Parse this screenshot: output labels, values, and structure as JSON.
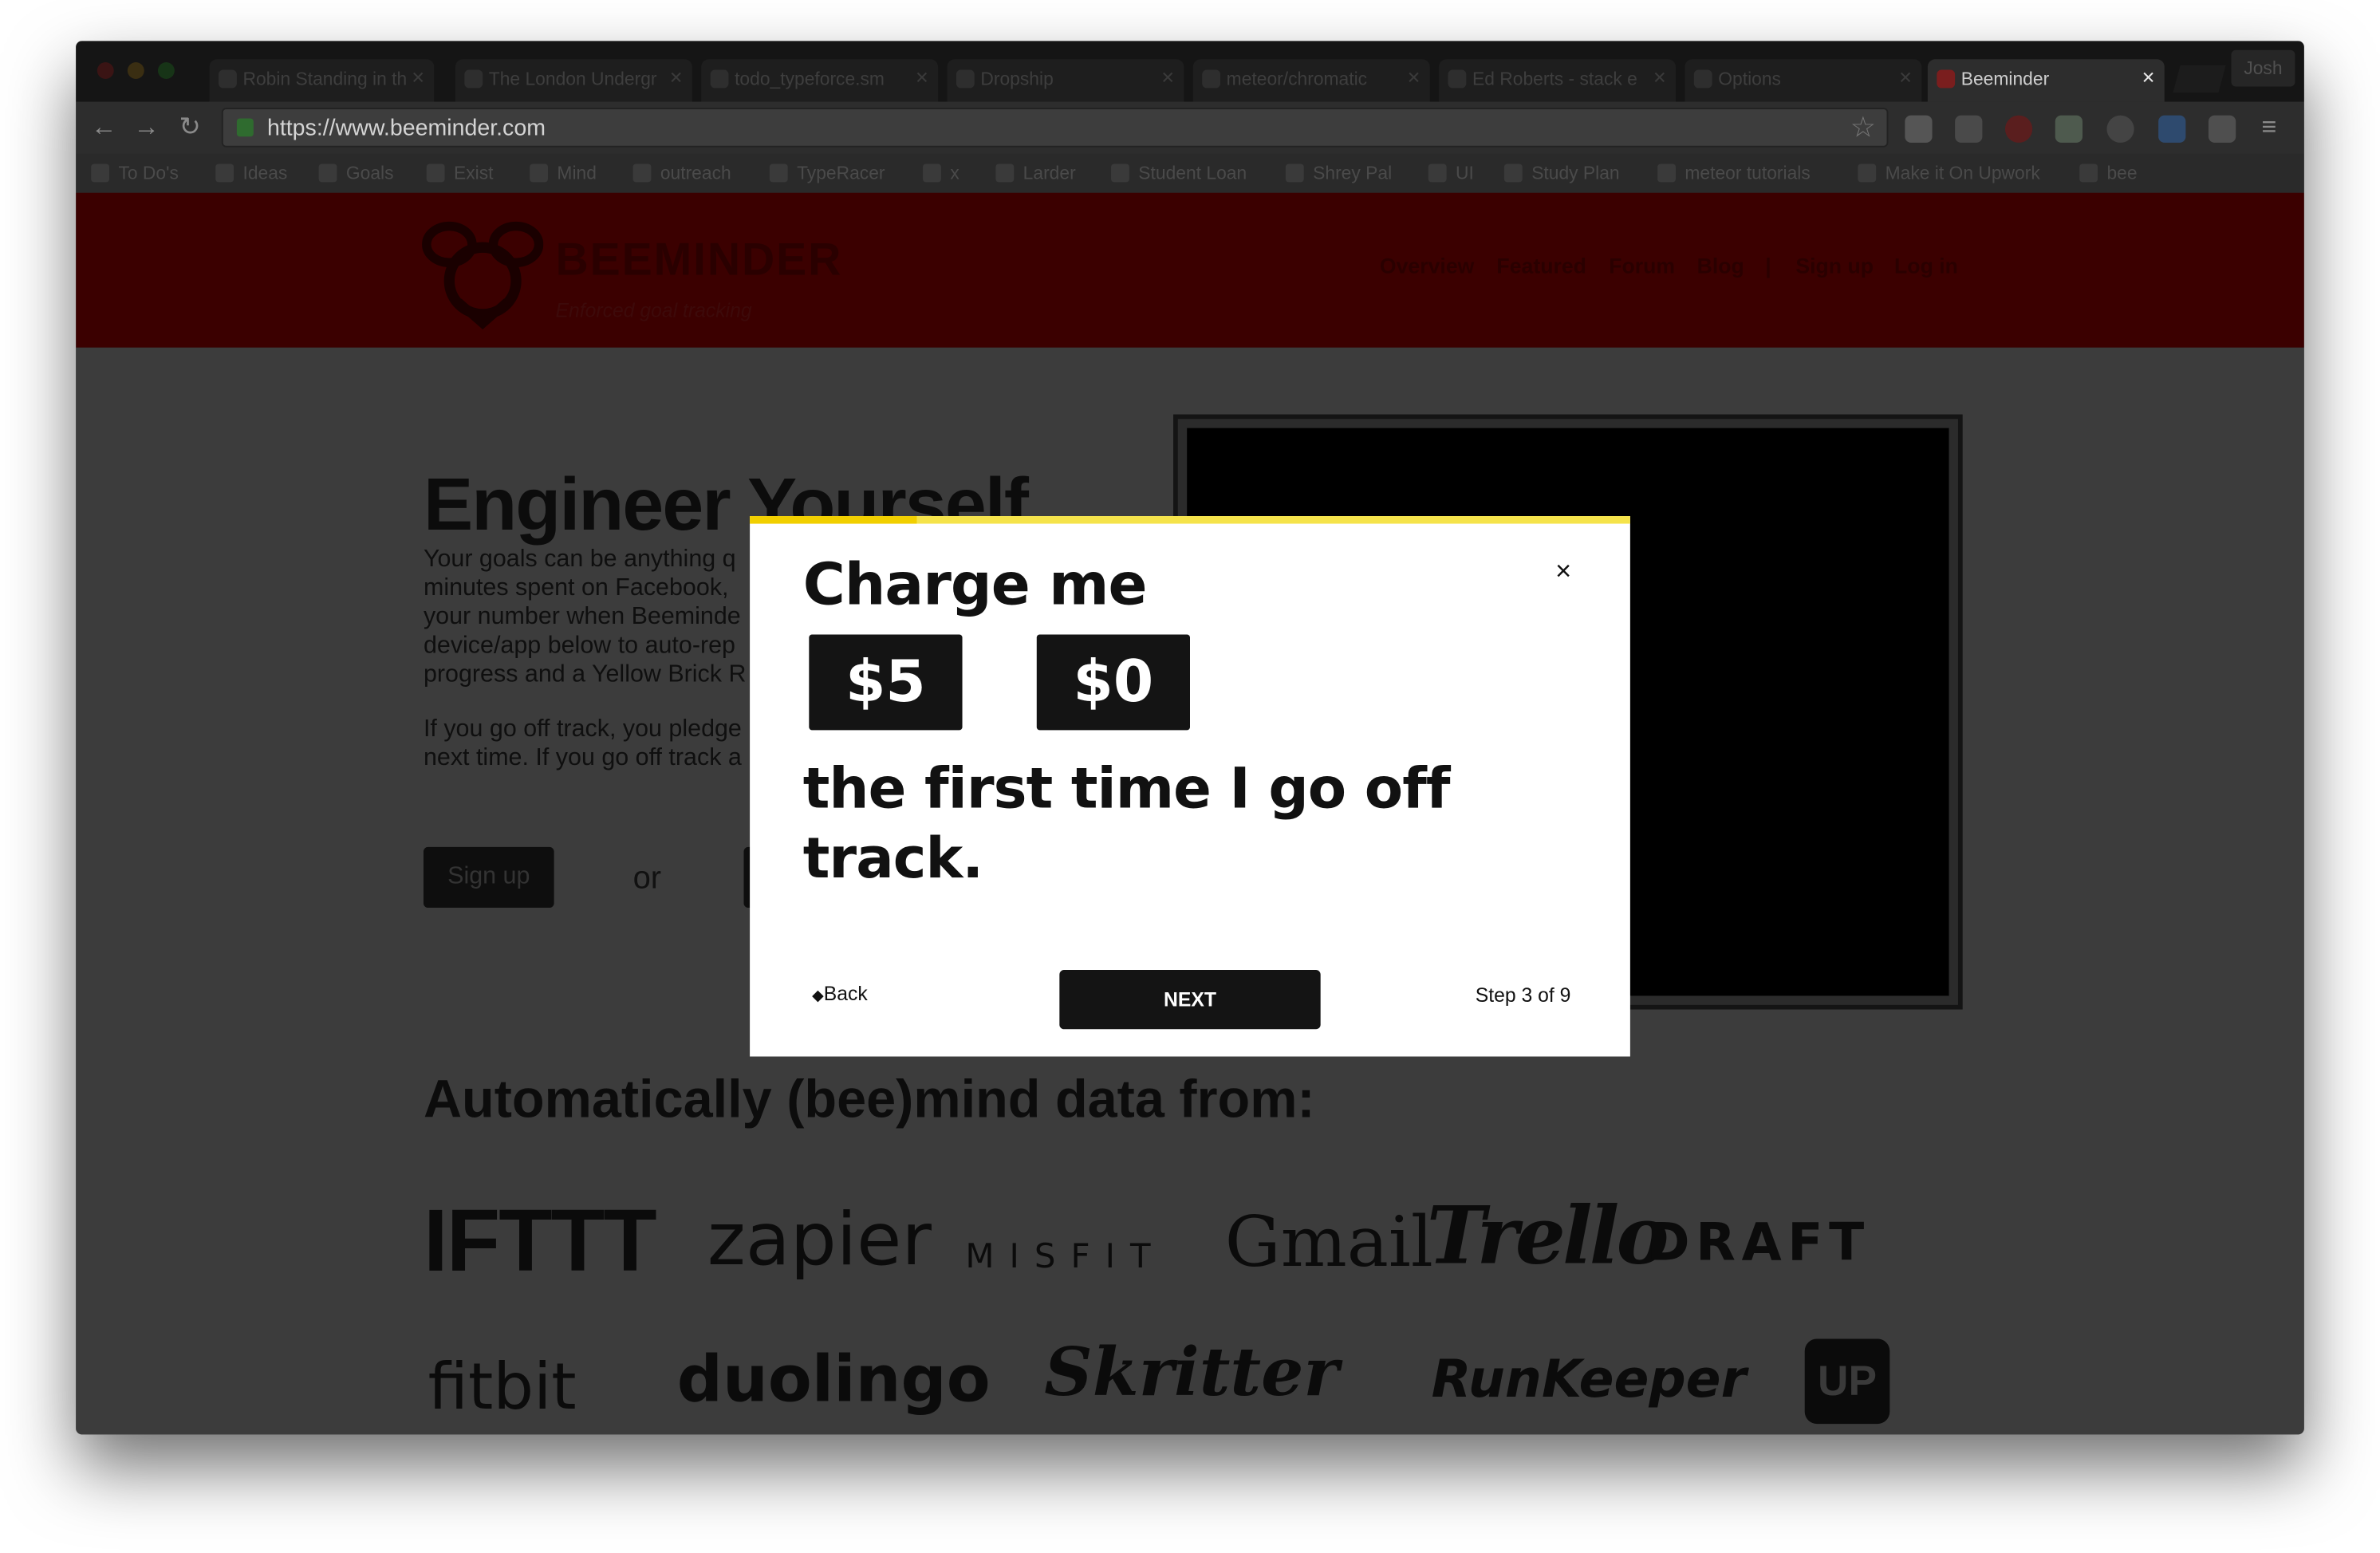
{
  "browser": {
    "tabs": [
      {
        "label": "Robin Standing in th"
      },
      {
        "label": "The London Undergr"
      },
      {
        "label": "todo_typeforce.sm"
      },
      {
        "label": "Dropship"
      },
      {
        "label": "meteor/chromatic"
      },
      {
        "label": "Ed Roberts - stack e"
      },
      {
        "label": "Options"
      },
      {
        "label": "Beeminder"
      }
    ],
    "profile": "Josh",
    "url": "https://www.beeminder.com",
    "bookmarks": [
      "To Do's",
      "Ideas",
      "Goals",
      "Exist",
      "Mind",
      "outreach",
      "TypeRacer",
      "x",
      "Larder",
      "Student Loan",
      "Shrey Pal",
      "UI",
      "Study Plan",
      "meteor tutorials",
      "Make it On Upwork",
      "bee"
    ]
  },
  "site": {
    "logo": "BEEMINDER",
    "tagline": "Enforced goal tracking",
    "nav": [
      "Overview",
      "Featured",
      "Forum",
      "Blog",
      "|",
      "Sign up",
      "Log in"
    ],
    "hero_title": "Engineer Yourself",
    "hero_para1": [
      "Your goals can be anything q",
      "minutes spent on Facebook, ",
      "your number when Beeminde",
      "device/app below to auto-rep",
      "progress and a Yellow Brick R"
    ],
    "hero_para2": [
      "If you go off track, you pledge",
      "next time. If you go off track a"
    ],
    "signup": "Sign up",
    "or": "or",
    "auto_title": "Automatically (bee)mind data from:",
    "brands_row1": [
      "IFTTT",
      "zapier",
      "MISFIT",
      "Gmail",
      "Trello",
      "DRAFT"
    ],
    "brands_row2": [
      "fitbit",
      "duolingo",
      "Skritter",
      "RunKeeper",
      "UP"
    ]
  },
  "modal": {
    "title": "Charge me",
    "close": "×",
    "amount1": "$5",
    "amount2": "$0",
    "sentence": "the first time I go off track.",
    "back": "Back",
    "next": "NEXT",
    "step": "Step 3 of 9",
    "progress_fraction": 0.19
  }
}
